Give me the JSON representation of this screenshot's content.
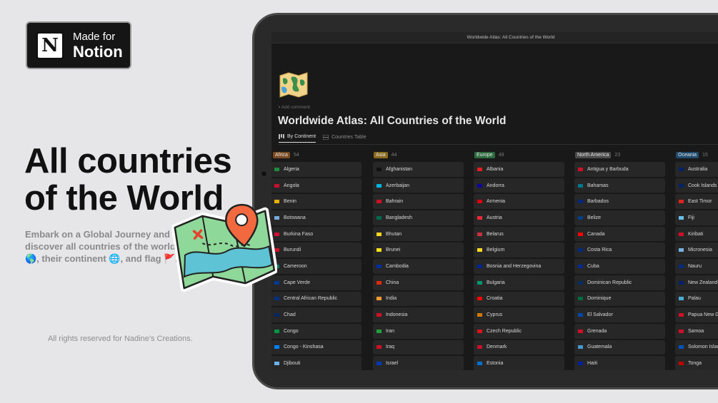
{
  "badge": {
    "line1": "Made for",
    "line2": "Notion",
    "logo_letter": "N"
  },
  "headline": "All countries of the World",
  "subtitle": "Embark on a Global Journey and discover all countries of the world 🌎, their continent 🌐, and flag 🚩.",
  "rights": "All rights reserved for Nadine's Creations.",
  "window_title": "Worldwide Atlas: All Countries of the World",
  "add_comment": "Add comment",
  "page_title": "Worldwide Atlas: All Countries of the World",
  "views": [
    {
      "label": "By Continent",
      "icon": "board-icon"
    },
    {
      "label": "Countries Table",
      "icon": "table-icon"
    }
  ],
  "columns": [
    {
      "name": "Africa",
      "count": "54",
      "color": "#7a4a21",
      "items": [
        "Algeria",
        "Angola",
        "Benin",
        "Botswana",
        "Burkina Faso",
        "Burundi",
        "Cameroon",
        "Cape Verde",
        "Central African Republic",
        "Chad",
        "Congo",
        "Congo - Kinshasa",
        "Djibouti"
      ],
      "flags": [
        "#1f8a3c",
        "#c8102e",
        "#e8b100",
        "#75aadb",
        "#d21034",
        "#ce1126",
        "#007a5e",
        "#003893",
        "#003082",
        "#002664",
        "#009543",
        "#007fff",
        "#6ab2e7"
      ]
    },
    {
      "name": "Asia",
      "count": "44",
      "color": "#8a6a1c",
      "items": [
        "Afghanistan",
        "Azerbaijan",
        "Bahrain",
        "Bangladesh",
        "Bhutan",
        "Brunei",
        "Cambodia",
        "China",
        "India",
        "Indonesia",
        "Iran",
        "Iraq",
        "Israel"
      ],
      "flags": [
        "#111111",
        "#00b5e2",
        "#ce1126",
        "#006a4e",
        "#ffd520",
        "#f7e017",
        "#032ea1",
        "#de2910",
        "#ff9933",
        "#ce1126",
        "#239f40",
        "#ce1126",
        "#0038b8"
      ]
    },
    {
      "name": "Europe",
      "count": "49",
      "color": "#2b6a3c",
      "items": [
        "Albania",
        "Andorra",
        "Armenia",
        "Austria",
        "Belarus",
        "Belgium",
        "Bosnia and Herzegovina",
        "Bulgaria",
        "Croatia",
        "Cyprus",
        "Czech Republic",
        "Denmark",
        "Estonia"
      ],
      "flags": [
        "#e41e20",
        "#10069f",
        "#d90012",
        "#ed2939",
        "#c8313e",
        "#fdda24",
        "#002395",
        "#00966e",
        "#ff0000",
        "#d57800",
        "#d7141a",
        "#c8102e",
        "#0072ce"
      ]
    },
    {
      "name": "North America",
      "count": "23",
      "color": "#4b4b4b",
      "items": [
        "Antigua y Barbuda",
        "Bahamas",
        "Barbados",
        "Belize",
        "Canada",
        "Costa Rica",
        "Cuba",
        "Dominican Republic",
        "Dominique",
        "El Salvador",
        "Grenada",
        "Guatemala",
        "Haiti"
      ],
      "flags": [
        "#ce1126",
        "#00778b",
        "#00267f",
        "#003f87",
        "#ff0000",
        "#002b7f",
        "#002a8f",
        "#002d62",
        "#006b3f",
        "#0047ab",
        "#ce1126",
        "#4997d0",
        "#00209f"
      ]
    },
    {
      "name": "Oceania",
      "count": "15",
      "color": "#1e4a6e",
      "items": [
        "Australia",
        "Cook Islands",
        "East Timor",
        "Fiji",
        "Kiribati",
        "Micronesia",
        "Nauru",
        "New Zealand",
        "Palau",
        "Papua New Guinea",
        "Samoa",
        "Solomon Islands",
        "Tonga"
      ],
      "flags": [
        "#012169",
        "#012169",
        "#dc241f",
        "#68bfe5",
        "#ce1126",
        "#75b2dd",
        "#002b7f",
        "#012169",
        "#4aadd6",
        "#ce1126",
        "#ce1126",
        "#0051ba",
        "#c10000"
      ]
    }
  ]
}
